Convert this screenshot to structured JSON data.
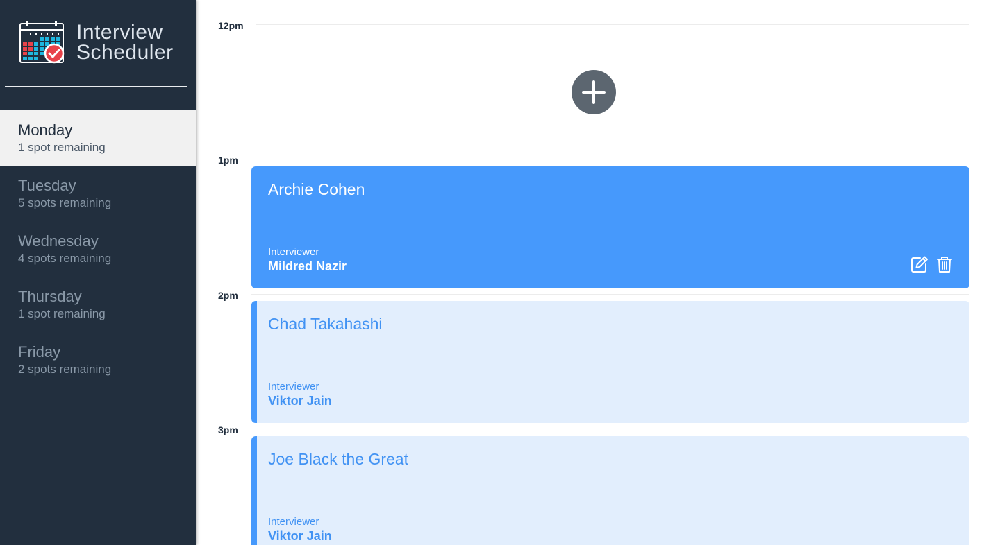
{
  "app": {
    "title_line1": "Interview",
    "title_line2": "Scheduler"
  },
  "colors": {
    "sidebar_bg": "#222f3e",
    "selected_day_bg": "#f1f1f1",
    "accent": "#4699fc",
    "appointment_light_bg": "#e2eefd",
    "add_button": "#5c6670",
    "coral_check": "#e8424a"
  },
  "sidebar": {
    "days": [
      {
        "name": "Monday",
        "spots": "1 spot remaining",
        "selected": true
      },
      {
        "name": "Tuesday",
        "spots": "5 spots remaining",
        "selected": false
      },
      {
        "name": "Wednesday",
        "spots": "4 spots remaining",
        "selected": false
      },
      {
        "name": "Thursday",
        "spots": "1 spot remaining",
        "selected": false
      },
      {
        "name": "Friday",
        "spots": "2 spots remaining",
        "selected": false
      }
    ]
  },
  "schedule": {
    "hours": [
      "12pm",
      "1pm",
      "2pm",
      "3pm"
    ],
    "appointments": [
      {
        "student": "Archie Cohen",
        "interviewer_label": "Interviewer",
        "interviewer": "Mildred Nazir",
        "state": "active"
      },
      {
        "student": "Chad Takahashi",
        "interviewer_label": "Interviewer",
        "interviewer": "Viktor Jain",
        "state": "default"
      },
      {
        "student": "Joe Black the Great",
        "interviewer_label": "Interviewer",
        "interviewer": "Viktor Jain",
        "state": "default"
      }
    ]
  },
  "icons": {
    "logo": "calendar-check-icon",
    "add": "plus-icon",
    "edit": "edit-icon",
    "delete": "trash-icon"
  }
}
